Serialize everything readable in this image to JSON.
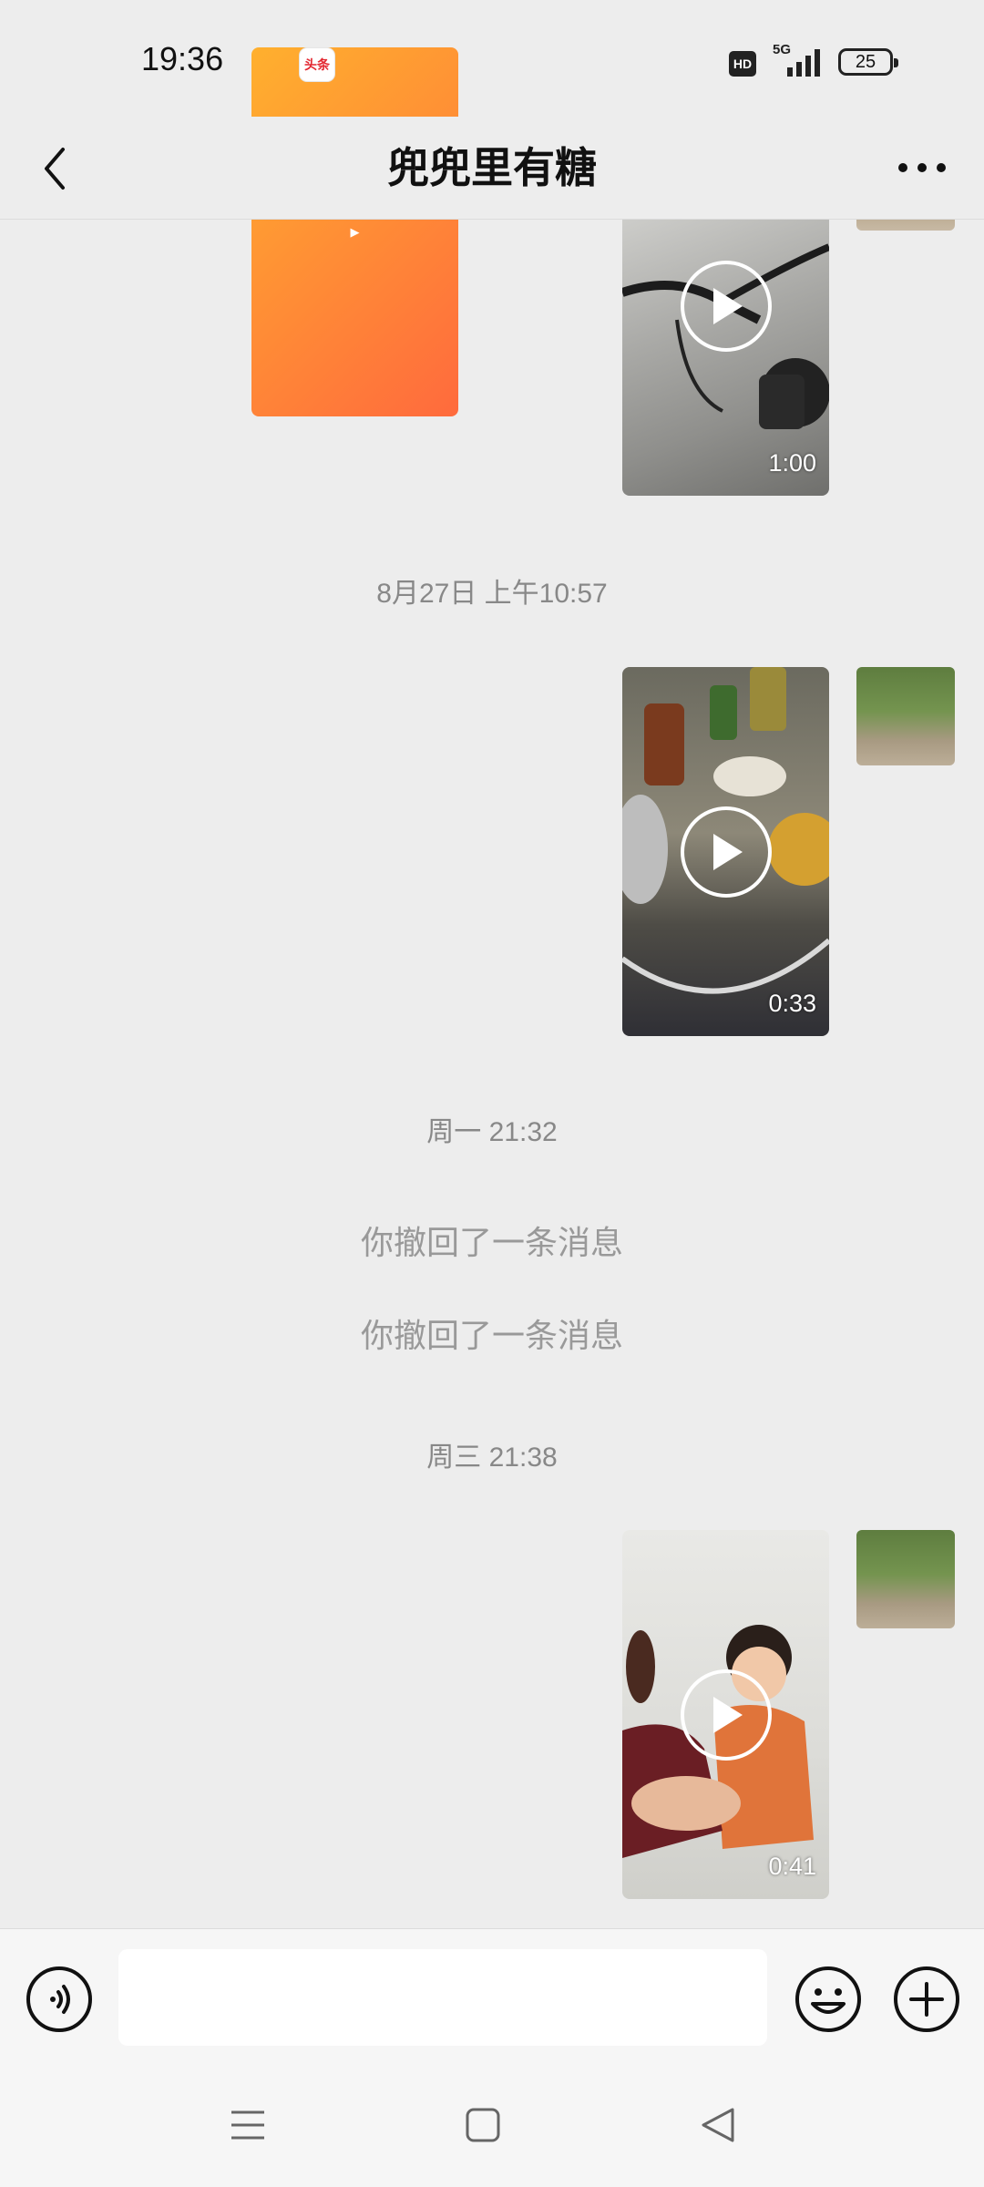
{
  "status_bar": {
    "time": "19:36",
    "app_badge_video": "▶",
    "app_badge_news": "头条",
    "hd": "HD",
    "network": "5G",
    "battery": "25"
  },
  "header": {
    "title": "兜兜里有糖"
  },
  "chat": {
    "messages": [
      {
        "type": "video",
        "duration": "1:00"
      },
      {
        "type": "timestamp",
        "text": "8月27日 上午10:57"
      },
      {
        "type": "video",
        "duration": "0:33"
      },
      {
        "type": "timestamp",
        "text": "周一 21:32"
      },
      {
        "type": "recall",
        "text": "你撤回了一条消息"
      },
      {
        "type": "recall",
        "text": "你撤回了一条消息"
      },
      {
        "type": "timestamp",
        "text": "周三 21:38"
      },
      {
        "type": "video",
        "duration": "0:41"
      }
    ]
  },
  "input": {
    "value": "",
    "placeholder": ""
  },
  "icons": [
    "back-icon",
    "more-icon",
    "voice-icon",
    "emoji-icon",
    "plus-icon",
    "menu-icon",
    "home-icon",
    "back-nav-icon",
    "play-icon"
  ],
  "colors": {
    "background": "#ededed",
    "input_bar": "#f6f6f6",
    "timestamp": "#888888",
    "recall": "#999999"
  }
}
